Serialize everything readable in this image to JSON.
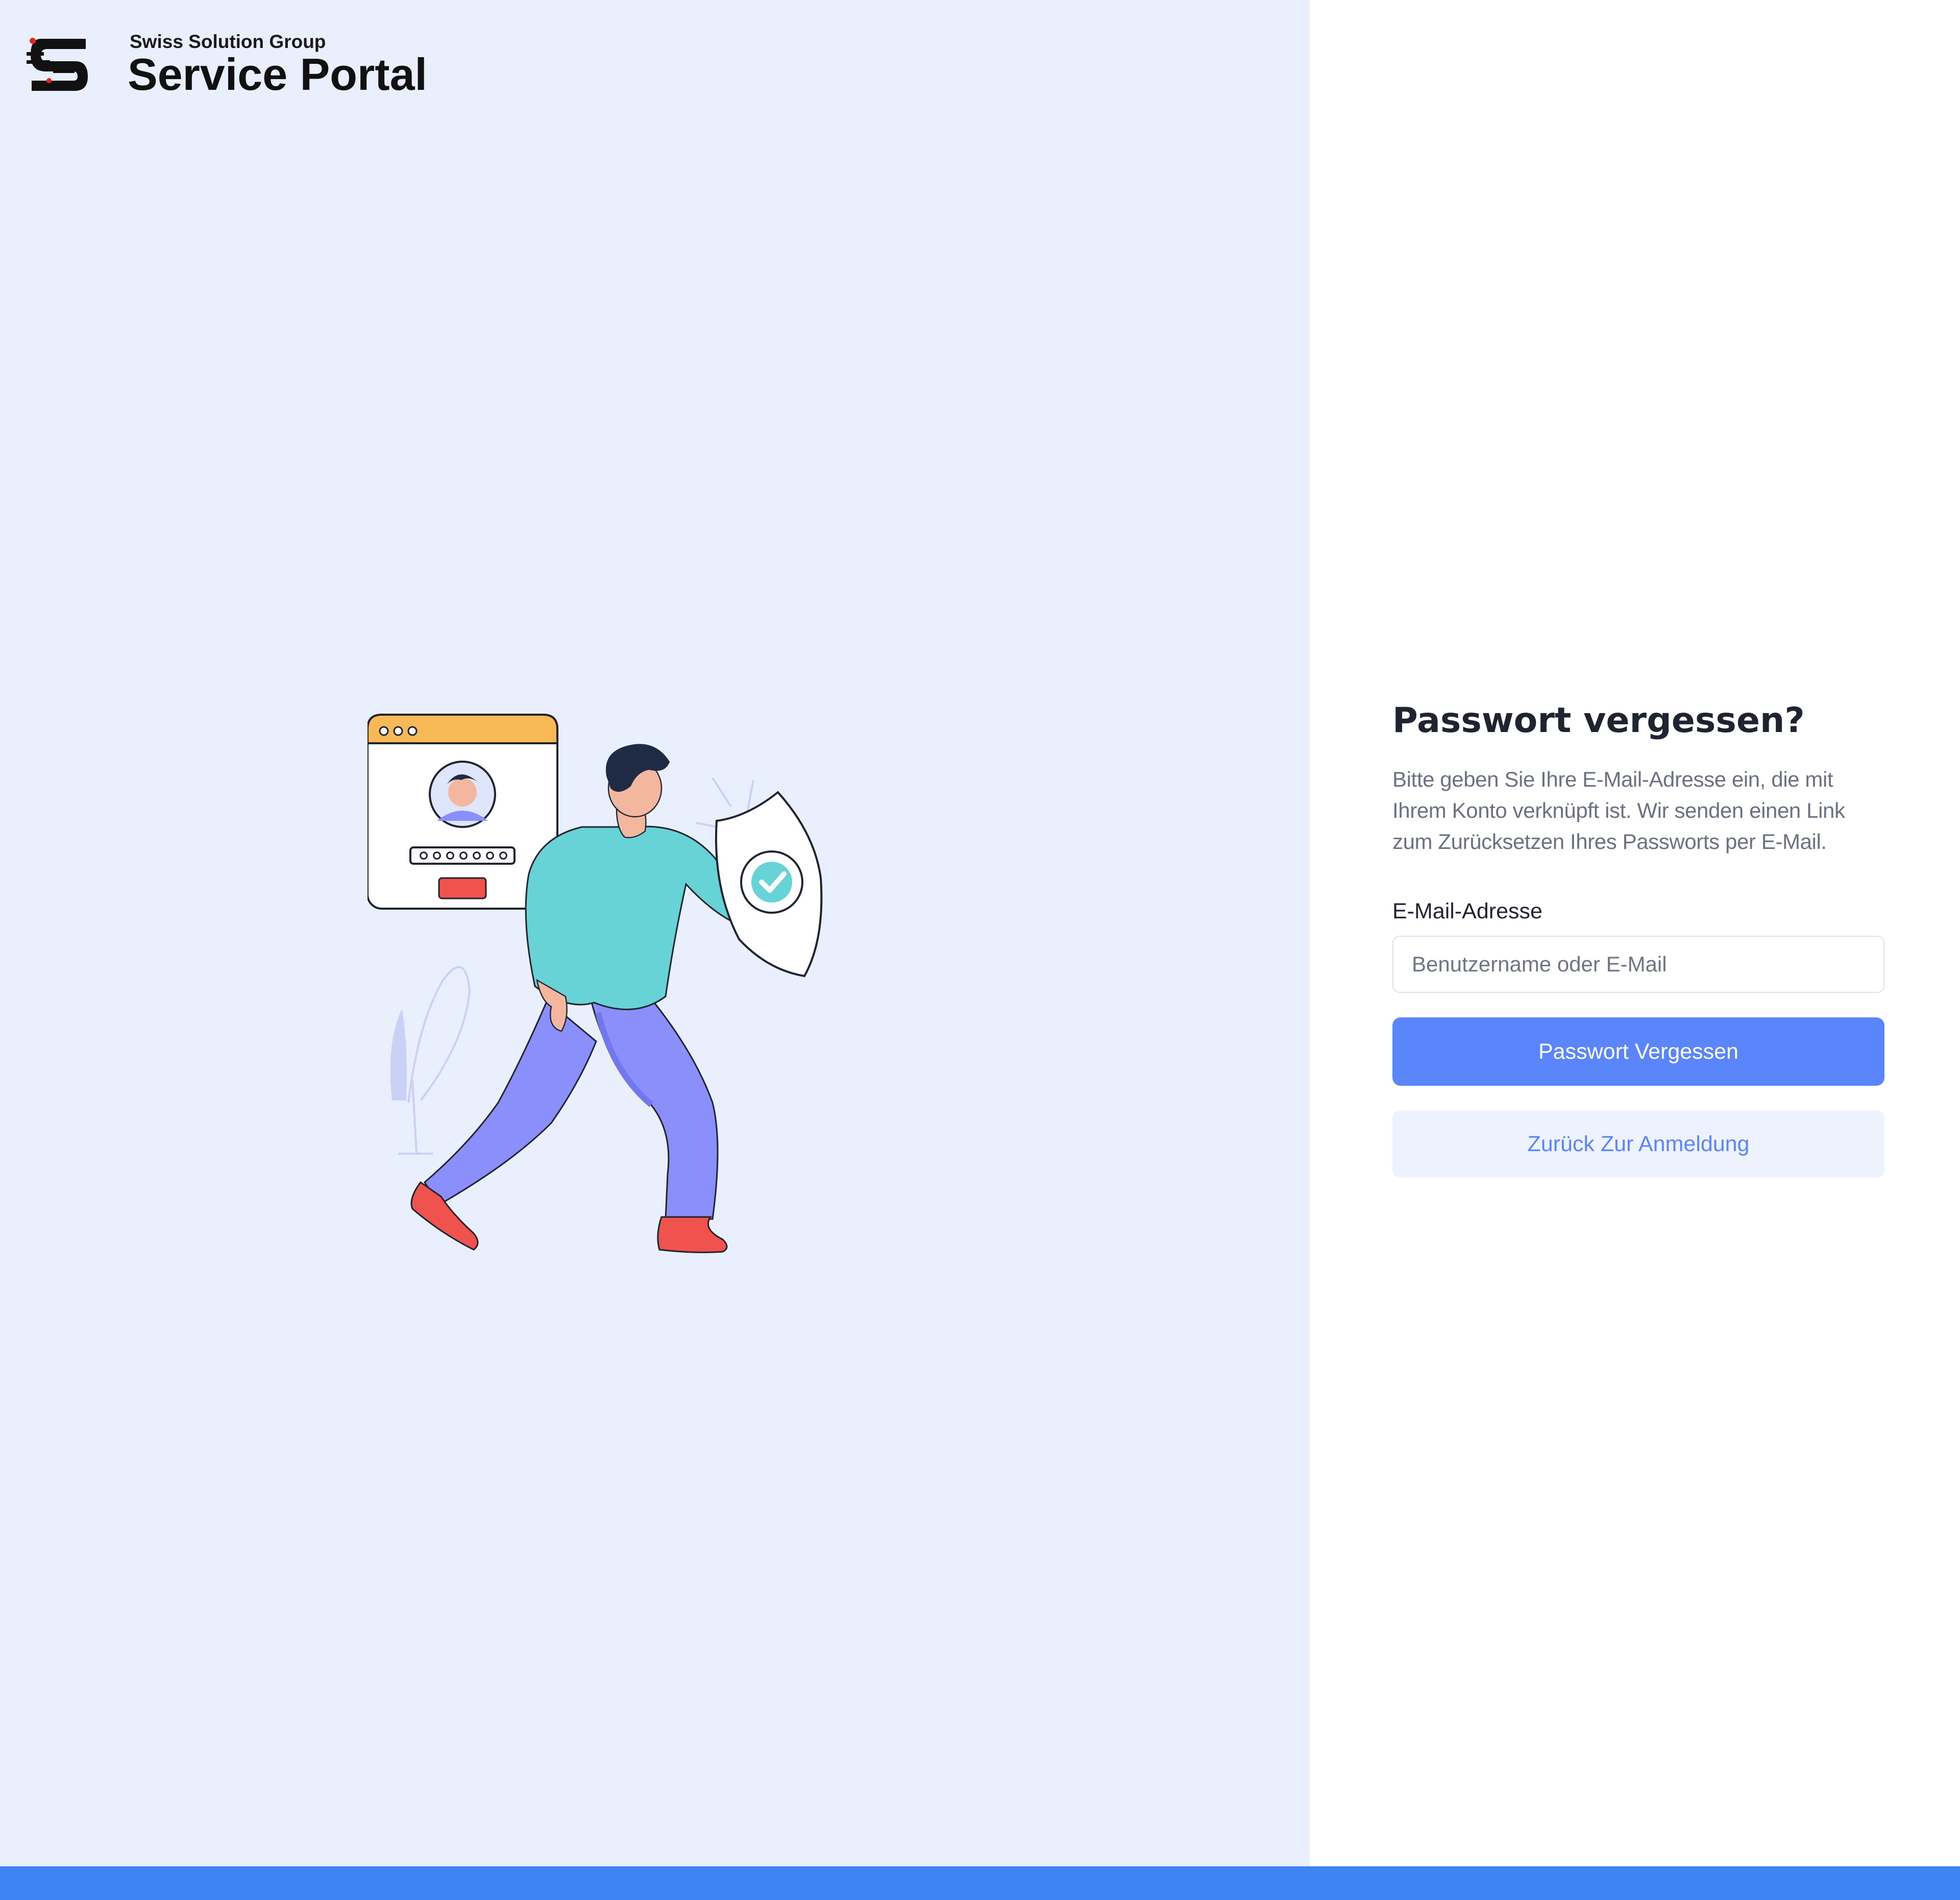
{
  "brand": {
    "subtitle": "Swiss Solution Group",
    "title": "Service Portal",
    "logo_icon": "ssg-s-logo-icon"
  },
  "illustration": {
    "name": "password-security-illustration",
    "window_dots": 3,
    "password_dots": 7
  },
  "form": {
    "title": "Passwort vergessen?",
    "description": "Bitte geben Sie Ihre E-Mail-Adresse ein, die mit Ihrem Konto verknüpft ist. Wir senden einen Link zum Zurücksetzen Ihres Passworts per E-Mail.",
    "email_label": "E-Mail-Adresse",
    "email_value": "",
    "email_placeholder": "Benutzername oder E-Mail",
    "submit_label": "Passwort Vergessen",
    "back_label": "Zurück Zur Anmeldung"
  },
  "colors": {
    "left_background": "#eaeffd",
    "primary": "#5b85fb",
    "secondary_bg": "#eef2fe",
    "footer_bar": "#3f84f5",
    "title_text": "#1f2430",
    "body_text": "#6b7180"
  }
}
